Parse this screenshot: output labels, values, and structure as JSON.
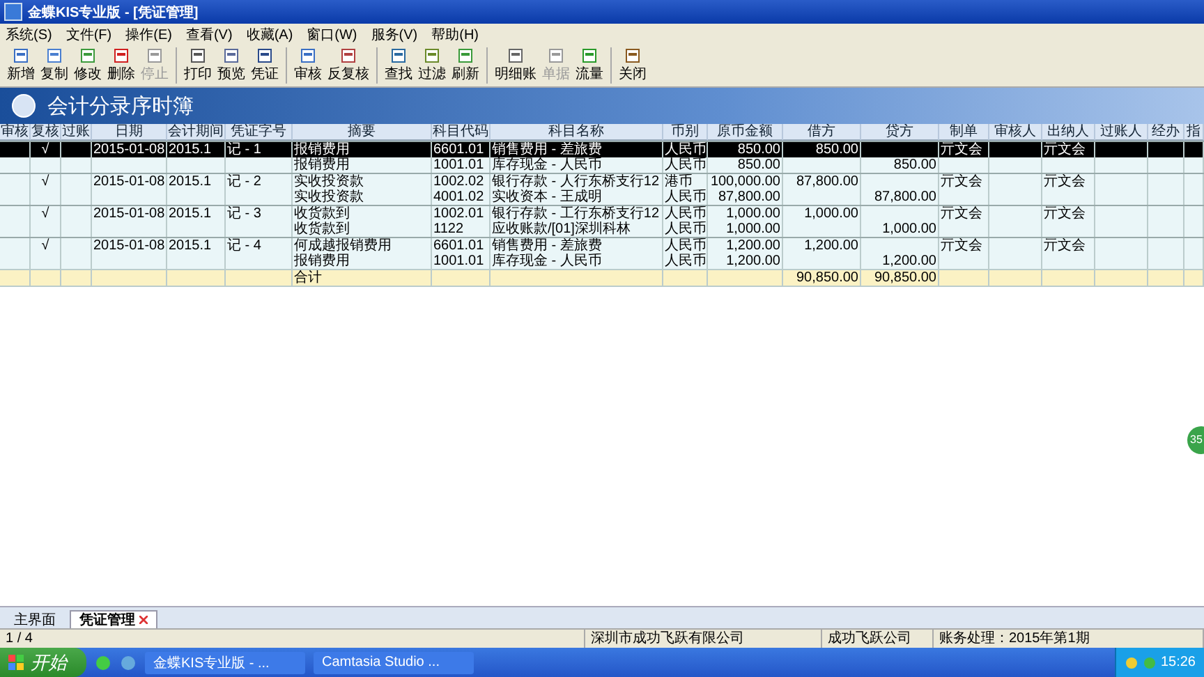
{
  "window": {
    "title": "金蝶KIS专业版 - [凭证管理]"
  },
  "menu": [
    "系统(S)",
    "文件(F)",
    "操作(E)",
    "查看(V)",
    "收藏(A)",
    "窗口(W)",
    "服务(V)",
    "帮助(H)"
  ],
  "toolbar": [
    {
      "label": "新增",
      "disabled": false,
      "group_end": false
    },
    {
      "label": "复制",
      "disabled": false,
      "group_end": false
    },
    {
      "label": "修改",
      "disabled": false,
      "group_end": false
    },
    {
      "label": "删除",
      "disabled": false,
      "group_end": false
    },
    {
      "label": "停止",
      "disabled": true,
      "group_end": true
    },
    {
      "label": "打印",
      "disabled": false,
      "group_end": false
    },
    {
      "label": "预览",
      "disabled": false,
      "group_end": false
    },
    {
      "label": "凭证",
      "disabled": false,
      "group_end": true
    },
    {
      "label": "审核",
      "disabled": false,
      "group_end": false
    },
    {
      "label": "反复核",
      "disabled": false,
      "group_end": true
    },
    {
      "label": "查找",
      "disabled": false,
      "group_end": false
    },
    {
      "label": "过滤",
      "disabled": false,
      "group_end": false
    },
    {
      "label": "刷新",
      "disabled": false,
      "group_end": true
    },
    {
      "label": "明细账",
      "disabled": false,
      "group_end": false
    },
    {
      "label": "单据",
      "disabled": true,
      "group_end": false
    },
    {
      "label": "流量",
      "disabled": false,
      "group_end": true
    },
    {
      "label": "关闭",
      "disabled": false,
      "group_end": false
    }
  ],
  "banner": {
    "title": "会计分录序时簿"
  },
  "table": {
    "columns": [
      "审核",
      "复核",
      "过账",
      "日期",
      "会计期间",
      "凭证字号",
      "摘要",
      "科目代码",
      "科目名称",
      "币别",
      "原币金额",
      "借方",
      "贷方",
      "制单",
      "审核人",
      "出纳人",
      "过账人",
      "经办",
      "指"
    ],
    "rows": [
      {
        "kind": "first",
        "selected": true,
        "reviewed": "√",
        "date": "2015-01-08",
        "period": "2015.1",
        "voucher_no": "记 - 1",
        "summary": "报销费用",
        "account_code": "6601.01",
        "account_name": "销售费用 - 差旅费",
        "currency": "人民币",
        "amount": "850.00",
        "debit": "850.00",
        "preparer": "亓文会",
        "cashier": "亓文会"
      },
      {
        "kind": "line",
        "selected": false,
        "summary": "报销费用",
        "account_code": "1001.01",
        "account_name": "库存现金 - 人民币",
        "currency": "人民币",
        "amount": "850.00",
        "credit": "850.00"
      },
      {
        "kind": "first",
        "selected": false,
        "reviewed": "√",
        "date": "2015-01-08",
        "period": "2015.1",
        "voucher_no": "记 - 2",
        "summary": "实收投资款",
        "account_code": "1002.02",
        "account_name": "银行存款 - 人行东桥支行12",
        "currency": "港币",
        "amount": "100,000.00",
        "debit": "87,800.00",
        "preparer": "亓文会",
        "cashier": "亓文会"
      },
      {
        "kind": "line",
        "selected": false,
        "summary": "实收投资款",
        "account_code": "4001.02",
        "account_name": "实收资本 - 王成明",
        "currency": "人民币",
        "amount": "87,800.00",
        "credit": "87,800.00"
      },
      {
        "kind": "first",
        "selected": false,
        "reviewed": "√",
        "date": "2015-01-08",
        "period": "2015.1",
        "voucher_no": "记 - 3",
        "summary": "收货款到",
        "account_code": "1002.01",
        "account_name": "银行存款 - 工行东桥支行12",
        "currency": "人民币",
        "amount": "1,000.00",
        "debit": "1,000.00",
        "preparer": "亓文会",
        "cashier": "亓文会"
      },
      {
        "kind": "line",
        "selected": false,
        "summary": "收货款到",
        "account_code": "1122",
        "account_name": "应收账款/[01]深圳科林",
        "currency": "人民币",
        "amount": "1,000.00",
        "credit": "1,000.00"
      },
      {
        "kind": "first",
        "selected": false,
        "reviewed": "√",
        "date": "2015-01-08",
        "period": "2015.1",
        "voucher_no": "记 - 4",
        "summary": "何成越报销费用",
        "account_code": "6601.01",
        "account_name": "销售费用 - 差旅费",
        "currency": "人民币",
        "amount": "1,200.00",
        "debit": "1,200.00",
        "preparer": "亓文会",
        "cashier": "亓文会"
      },
      {
        "kind": "line",
        "selected": false,
        "summary": "报销费用",
        "account_code": "1001.01",
        "account_name": "库存现金 - 人民币",
        "currency": "人民币",
        "amount": "1,200.00",
        "credit": "1,200.00"
      },
      {
        "kind": "total",
        "selected": false,
        "summary": "合计",
        "debit": "90,850.00",
        "credit": "90,850.00"
      }
    ]
  },
  "floating_ball": {
    "text": "35"
  },
  "tabs": [
    {
      "label": "主界面",
      "selected": false,
      "closable": false
    },
    {
      "label": "凭证管理",
      "selected": true,
      "closable": true
    }
  ],
  "status_bar": [
    "1 / 4",
    "深圳市成功飞跃有限公司",
    "成功飞跃公司",
    "账务处理：2015年第1期"
  ],
  "taskbar": {
    "start": "开始",
    "windows": [
      {
        "label": "金蝶KIS专业版 - ...",
        "selected": false
      },
      {
        "label": "Camtasia Studio ...",
        "selected": false
      }
    ],
    "clock": "15:26"
  }
}
